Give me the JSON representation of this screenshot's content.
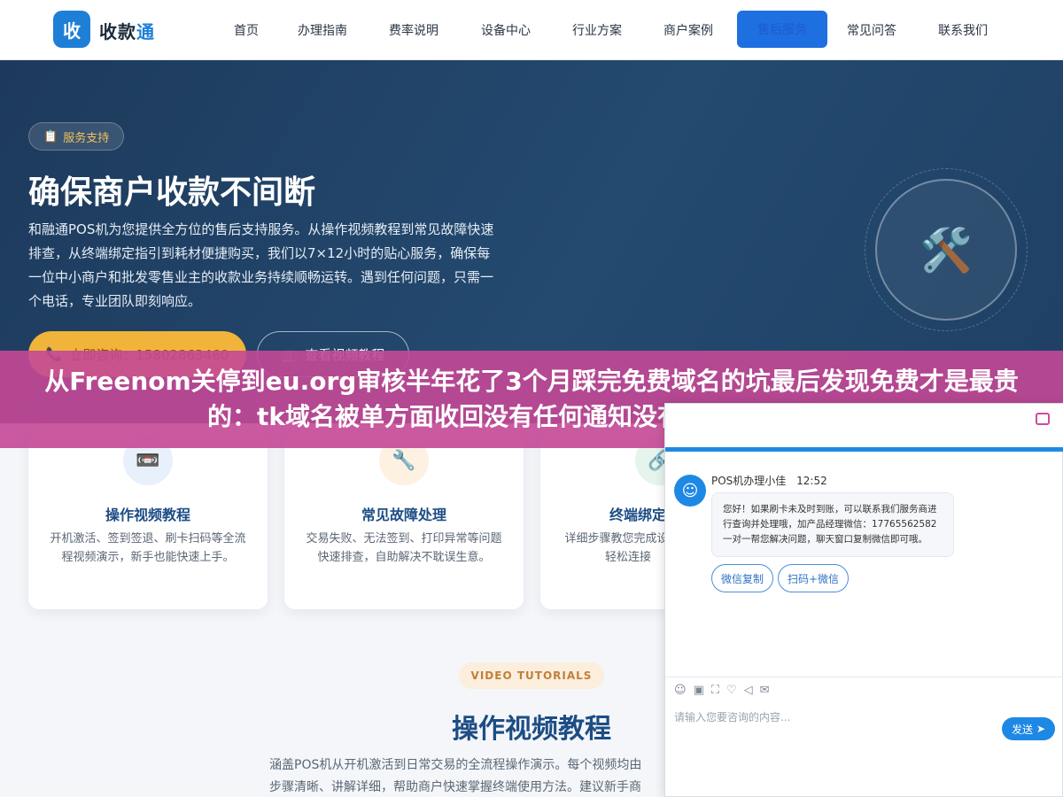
{
  "nav": {
    "logo_mark": "收",
    "logo_text_a": "收款",
    "logo_text_b": "通",
    "items": [
      "首页",
      "办理指南",
      "费率说明",
      "设备中心",
      "行业方案",
      "商户案例",
      "售后服务",
      "常见问答",
      "联系我们"
    ]
  },
  "hero": {
    "tag": "服务支持",
    "tag_icon": "📋",
    "title": "确保商户收款不间断",
    "description": "和融通POS机为您提供全方位的售后支持服务。从操作视频教程到常见故障快速排查，从终端绑定指引到耗材便捷购买，我们以7×12小时的贴心服务，确保每一位中小商户和批发零售业主的收款业务持续顺畅运转。遇到任何问题，只需一个电话，专业团队即刻响应。",
    "consult_icon": "📞",
    "consult_label": "立即咨询：15802863460",
    "video_icon": "📺",
    "video_label": "查看视频教程",
    "emblem_icon": "🛠️"
  },
  "banner": {
    "text": "从Freenom关停到eu.org审核半年花了3个月踩完免费域名的坑最后发现免费才是最贵的：tk域名被单方面收回没有任何通知没有申诉渠道三个月"
  },
  "cards": [
    {
      "icon": "📼",
      "title": "操作视频教程",
      "desc": "开机激活、签到签退、刷卡扫码等全流程视频演示，新手也能快速上手。",
      "icon_bg": "#e8f1fb"
    },
    {
      "icon": "🔧",
      "title": "常见故障处理",
      "desc": "交易失败、无法签到、打印异常等问题快速排查，自助解决不耽误生意。",
      "icon_bg": "#fdf1e2"
    },
    {
      "icon": "🔗",
      "title": "终端绑定",
      "desc": "详细步骤教您完成设置，轻松连接",
      "icon_bg": "#e6f5ec"
    }
  ],
  "video_section": {
    "pill": "VIDEO TUTORIALS",
    "title": "操作视频教程",
    "desc_line1": "涵盖POS机从开机激活到日常交易的全流程操作演示。每个视频均由",
    "desc_line2": "步骤清晰、讲解详细，帮助商户快速掌握终端使用方法。建议新手商"
  },
  "chat": {
    "agent_name": "POS机办理小佳",
    "time": "12:52",
    "message": "您好！如果刷卡未及时到账，可以联系我们服务商进行查询并处理哦，加产品经理微信：17765562582 一对一帮您解决问题，聊天窗口复制微信即可哦。",
    "chip_1": "微信复制",
    "chip_2": "扫码+微信",
    "tools": [
      "☺",
      "▣",
      "⛶",
      "♡",
      "◁",
      "✉"
    ],
    "input_placeholder": "请输入您要咨询的内容...",
    "send_label": "发送",
    "send_icon": "➤"
  },
  "colors": {
    "primary": "#1f7fd6",
    "hero_bg": "#1d3a5c",
    "accent_gold": "#f0b43a",
    "banner": "#c44896"
  }
}
